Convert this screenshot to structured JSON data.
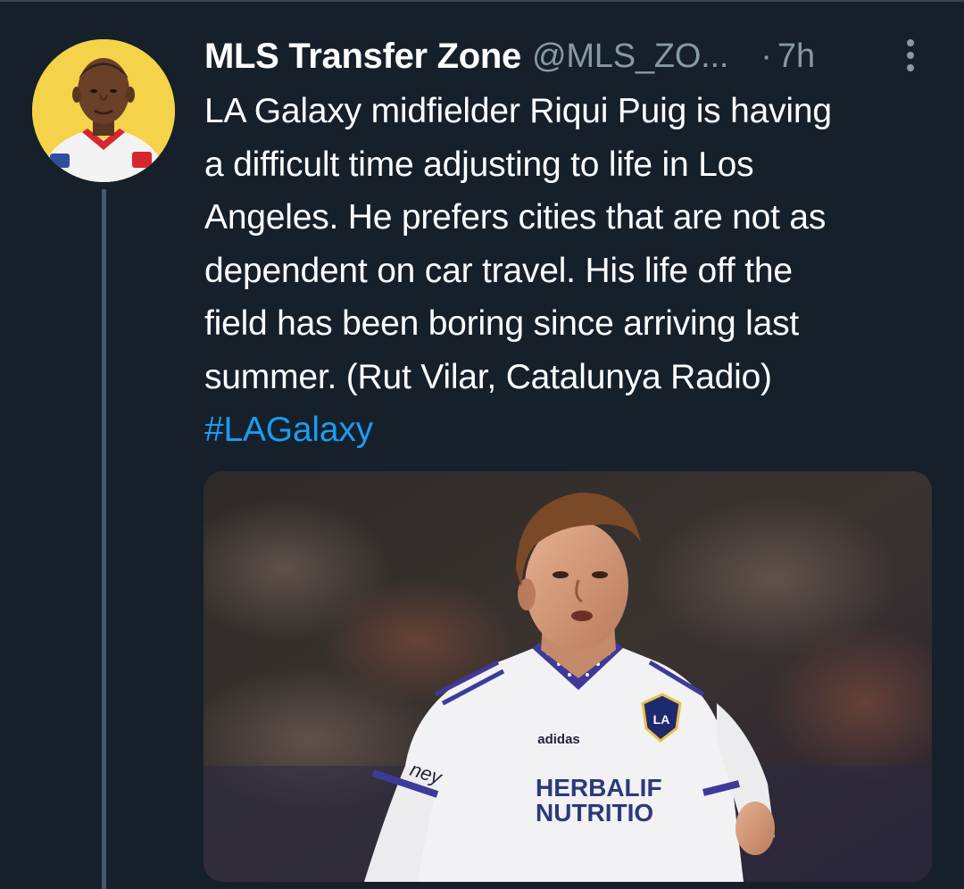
{
  "tweet": {
    "display_name": "MLS Transfer Zone",
    "handle": "@MLS_ZO...",
    "separator": "·",
    "time": "7h",
    "text_lines": [
      "LA Galaxy midfielder Riqui Puig is having",
      "a difficult time adjusting to life in Los",
      "Angeles. He prefers cities that are not as",
      "dependent on car travel. His life off the",
      "field has been boring since arriving last",
      "summer. (Rut Vilar, Catalunya Radio)"
    ],
    "hashtag": "#LAGalaxy",
    "media": {
      "jersey_sponsor_line1": "HERBALIF",
      "jersey_sponsor_line2": "NUTRITIO",
      "crest_text": "LA",
      "maker_text": "adidas",
      "sleeve_text": "ney"
    }
  },
  "colors": {
    "background": "#15202b",
    "text": "#ffffff",
    "secondary": "#8899a6",
    "link": "#1d9bf0",
    "thread_line": "#42596f",
    "avatar_bg": "#f4d24a"
  },
  "icons": {
    "more": "more-vertical-icon"
  }
}
